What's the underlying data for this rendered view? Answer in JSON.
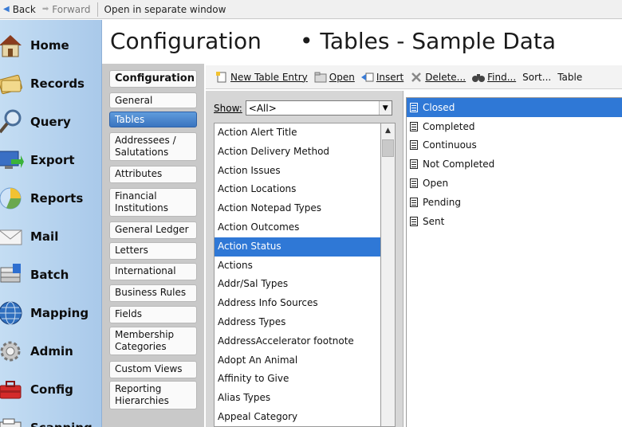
{
  "nav": {
    "back_label": "Back",
    "forward_label": "Forward",
    "open_separate_label": "Open in separate window"
  },
  "sidebar": {
    "items": [
      {
        "label": "Home",
        "icon": "home-icon"
      },
      {
        "label": "Records",
        "icon": "records-icon"
      },
      {
        "label": "Query",
        "icon": "query-icon"
      },
      {
        "label": "Export",
        "icon": "export-icon"
      },
      {
        "label": "Reports",
        "icon": "reports-icon"
      },
      {
        "label": "Mail",
        "icon": "mail-icon"
      },
      {
        "label": "Batch",
        "icon": "batch-icon"
      },
      {
        "label": "Mapping",
        "icon": "mapping-icon"
      },
      {
        "label": "Admin",
        "icon": "admin-icon"
      },
      {
        "label": "Config",
        "icon": "config-icon"
      },
      {
        "label": "Scanning",
        "icon": "scanning-icon"
      }
    ]
  },
  "header": {
    "title": "Configuration",
    "subtitle": "• Tables - Sample Data"
  },
  "categories": {
    "heading": "Configuration",
    "items": [
      "General",
      "Tables",
      "Addressees / Salutations",
      "Attributes",
      "Financial Institutions",
      "General Ledger",
      "Letters",
      "International",
      "Business Rules",
      "Fields",
      "Membership Categories",
      "Custom Views",
      "Reporting Hierarchies"
    ],
    "selected": "Tables"
  },
  "toolbar": {
    "new_entry": "New Table Entry",
    "open": "Open",
    "insert": "Insert",
    "delete": "Delete...",
    "find": "Find...",
    "sort": "Sort...",
    "table": "Table"
  },
  "filter": {
    "show_label": "Show:",
    "value": "<All>"
  },
  "tables": {
    "items": [
      "Action Alert Title",
      "Action Delivery Method",
      "Action Issues",
      "Action Locations",
      "Action Notepad Types",
      "Action Outcomes",
      "Action Status",
      "Actions",
      "Addr/Sal Types",
      "Address Info Sources",
      "Address Types",
      "AddressAccelerator footnote",
      "Adopt An Animal",
      "Affinity to Give",
      "Alias Types",
      "Appeal  Category"
    ],
    "selected": "Action Status"
  },
  "values": {
    "items": [
      "Closed",
      "Completed",
      "Continuous",
      "Not Completed",
      "Open",
      "Pending",
      "Sent"
    ],
    "selected": "Closed"
  },
  "colors": {
    "selection": "#2f78d6",
    "sidebar": "#b7d3ef",
    "panel_grey": "#c9c9c9"
  }
}
